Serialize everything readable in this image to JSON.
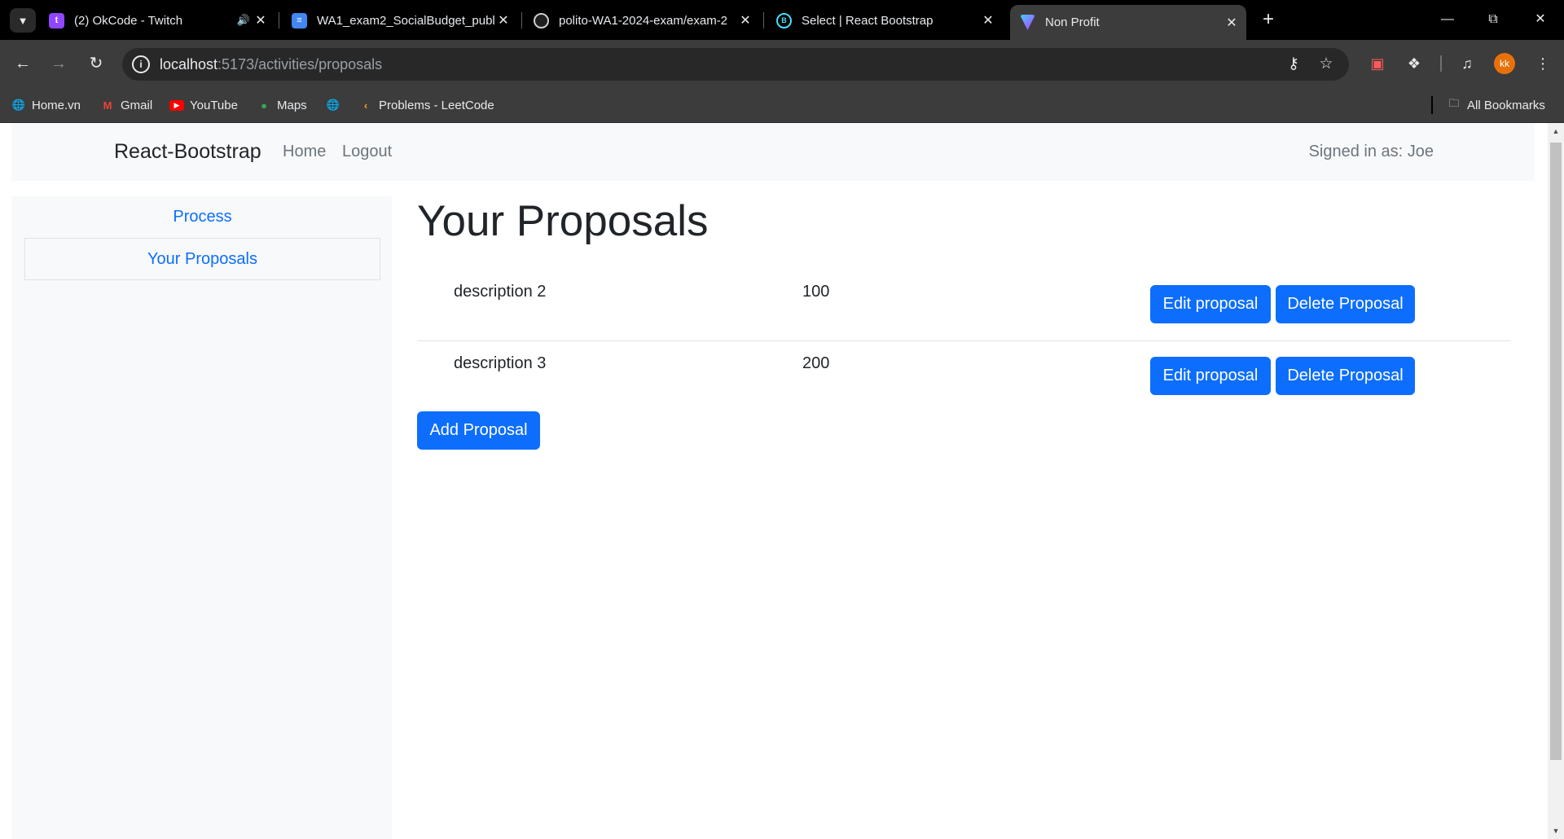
{
  "browser": {
    "tabs": [
      {
        "title": "(2) OkCode - Twitch",
        "favicon": "twitch-icon",
        "color": "#9146ff",
        "audio": true
      },
      {
        "title": "WA1_exam2_SocialBudget_publ",
        "favicon": "google-docs-icon",
        "color": "#4285f4"
      },
      {
        "title": "polito-WA1-2024-exam/exam-2",
        "favicon": "github-icon",
        "color": "#ffffff"
      },
      {
        "title": "Select | React Bootstrap",
        "favicon": "react-bootstrap-icon",
        "color": "#41e0fd"
      },
      {
        "title": "Non Profit",
        "favicon": "vite-icon",
        "color": "#bd34fe",
        "active": true
      }
    ],
    "url_host": "localhost",
    "url_rest": ":5173/activities/proposals",
    "profile_initials": "kk",
    "bookmarks": [
      {
        "label": "Home.vn",
        "icon": "globe-icon"
      },
      {
        "label": "Gmail",
        "icon": "gmail-icon"
      },
      {
        "label": "YouTube",
        "icon": "youtube-icon"
      },
      {
        "label": "Maps",
        "icon": "maps-icon"
      },
      {
        "label": "",
        "icon": "globe-icon"
      },
      {
        "label": "Problems - LeetCode",
        "icon": "leetcode-icon"
      }
    ],
    "all_bookmarks_label": "All Bookmarks"
  },
  "navbar": {
    "brand": "React-Bootstrap",
    "links": [
      "Home",
      "Logout"
    ],
    "signed_in": "Signed in as: Joe"
  },
  "sidebar": {
    "items": [
      {
        "label": "Process"
      },
      {
        "label": "Your Proposals"
      }
    ]
  },
  "main": {
    "title": "Your Proposals",
    "proposals": [
      {
        "description": "description 2",
        "amount": "100"
      },
      {
        "description": "description 3",
        "amount": "200"
      }
    ],
    "edit_label": "Edit proposal",
    "delete_label": "Delete Proposal",
    "add_label": "Add Proposal"
  },
  "colors": {
    "primary": "#0d6efd",
    "navbar_bg": "#f8f9fa",
    "link_muted": "#6c757d"
  }
}
